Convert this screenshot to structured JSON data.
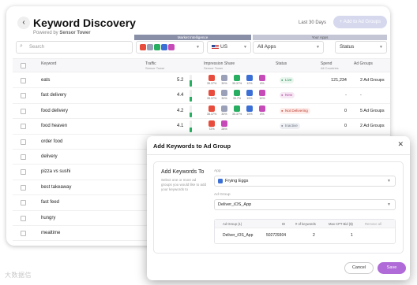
{
  "header": {
    "title": "Keyword Discovery",
    "powered_by": "Powered by",
    "powered_brand": "Sensor Tower",
    "date_range": "Last 30 Days",
    "add_button": "+ Add to Ad Groups",
    "back_icon": "chevron-left-icon"
  },
  "bands": {
    "market": "Market Intelligence",
    "your_apps": "Your Apps"
  },
  "filters": {
    "search_placeholder": "Search",
    "country": "US",
    "apps": "All Apps",
    "status": "Status"
  },
  "columns": {
    "keyword": "Keyword",
    "traffic": "Traffic",
    "traffic_sub": "Sensor Tower",
    "impression": "Impression Share",
    "impression_sub": "Sensor Tower",
    "status": "Status",
    "spend": "Spend",
    "spend_sub": "All Countries",
    "ad_groups": "Ad Groups"
  },
  "colors": {
    "accent": "#b06bd8",
    "green": "#27ae60",
    "grey_band": "#8a8fa8"
  },
  "rows": [
    {
      "keyword": "eats",
      "traffic": "5.2",
      "traffic_pct": 0.52,
      "status": "Live",
      "status_kind": "live",
      "spend": "121,234",
      "ad_groups": "2 Ad Groups",
      "impressions": [
        {
          "pct": "35.37%",
          "color": "#e74c3c"
        },
        {
          "pct": "30%",
          "color": "#9aa0b8"
        },
        {
          "pct": "35.37%",
          "color": "#27ae60"
        },
        {
          "pct": "12%",
          "color": "#3b6fd6"
        },
        {
          "pct": "8%",
          "color": "#c64bb8"
        }
      ]
    },
    {
      "keyword": "fast delivery",
      "traffic": "4.4",
      "traffic_pct": 0.44,
      "status": "New",
      "status_kind": "new",
      "spend": "-",
      "ad_groups": "-",
      "impressions": [
        {
          "pct": "35.37%",
          "color": "#e74c3c"
        },
        {
          "pct": "30%",
          "color": "#9aa0b8"
        },
        {
          "pct": "35.7%",
          "color": "#27ae60"
        },
        {
          "pct": "15%",
          "color": "#3b6fd6"
        },
        {
          "pct": "10%",
          "color": "#c64bb8"
        }
      ]
    },
    {
      "keyword": "food delivery",
      "traffic": "4.2",
      "traffic_pct": 0.42,
      "status": "Not Delivering",
      "status_kind": "nd",
      "spend": "0",
      "ad_groups": "5 Ad Groups",
      "impressions": [
        {
          "pct": "35.37%",
          "color": "#e74c3c"
        },
        {
          "pct": "30%",
          "color": "#9aa0b8"
        },
        {
          "pct": "35.37%",
          "color": "#27ae60"
        },
        {
          "pct": "15%",
          "color": "#3b6fd6"
        },
        {
          "pct": "8%",
          "color": "#c64bb8"
        }
      ]
    },
    {
      "keyword": "food heaven",
      "traffic": "4.1",
      "traffic_pct": 0.41,
      "status": "Inactive",
      "status_kind": "in",
      "spend": "0",
      "ad_groups": "2 Ad Groups",
      "impressions": [
        {
          "pct": "72%",
          "color": "#e74c3c"
        },
        {
          "pct": "28%",
          "color": "#c64bb8"
        }
      ]
    },
    {
      "keyword": "order food"
    },
    {
      "keyword": "delivery"
    },
    {
      "keyword": "pizza vs sushi"
    },
    {
      "keyword": "best takeaway"
    },
    {
      "keyword": "fast feed"
    },
    {
      "keyword": "hungry"
    },
    {
      "keyword": "mealtime"
    }
  ],
  "modal": {
    "title": "Add Keywords to Ad Group",
    "section_title": "Add Keywords To",
    "help": "Select one or more ad groups you would like to add your keywords to",
    "app_label": "App",
    "app_value": "Frying Eggs",
    "adgroup_label": "Ad Group",
    "adgroup_value": "Deliver_iOS_App",
    "table_headers": {
      "name": "Ad Group (1)",
      "id": "ID",
      "keywords": "# of keywords",
      "bid": "Max CPT Bid ($)",
      "remove": "Remove all"
    },
    "table_row": {
      "name": "Deliver_iOS_App",
      "id": "502729304",
      "keywords": "2",
      "bid": "1"
    },
    "cancel": "Cancel",
    "save": "Save"
  },
  "watermark": "大数据信"
}
